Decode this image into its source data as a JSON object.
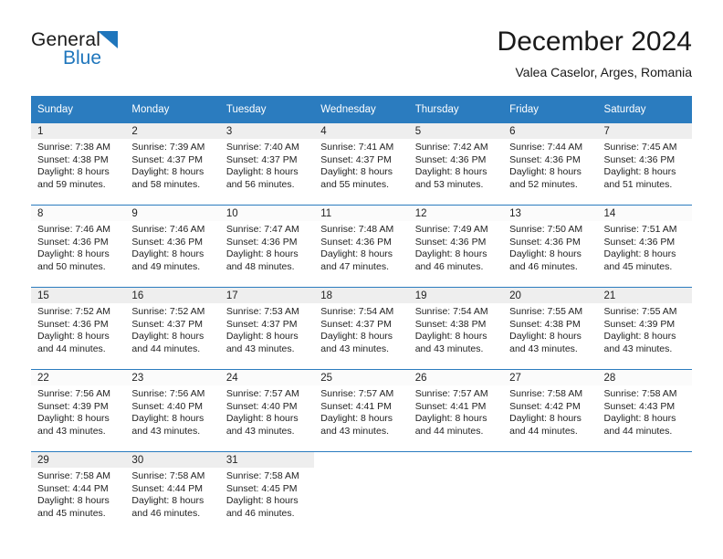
{
  "brand": {
    "name_part1": "General",
    "name_part2": "Blue",
    "accent_color": "#1f76bc"
  },
  "header": {
    "title": "December 2024",
    "subtitle": "Valea Caselor, Arges, Romania"
  },
  "calendar": {
    "header_bg": "#2b7cbf",
    "weekday_headers": [
      "Sunday",
      "Monday",
      "Tuesday",
      "Wednesday",
      "Thursday",
      "Friday",
      "Saturday"
    ],
    "weeks": [
      [
        {
          "day": "1",
          "sunrise": "Sunrise: 7:38 AM",
          "sunset": "Sunset: 4:38 PM",
          "daylight_line1": "Daylight: 8 hours",
          "daylight_line2": "and 59 minutes."
        },
        {
          "day": "2",
          "sunrise": "Sunrise: 7:39 AM",
          "sunset": "Sunset: 4:37 PM",
          "daylight_line1": "Daylight: 8 hours",
          "daylight_line2": "and 58 minutes."
        },
        {
          "day": "3",
          "sunrise": "Sunrise: 7:40 AM",
          "sunset": "Sunset: 4:37 PM",
          "daylight_line1": "Daylight: 8 hours",
          "daylight_line2": "and 56 minutes."
        },
        {
          "day": "4",
          "sunrise": "Sunrise: 7:41 AM",
          "sunset": "Sunset: 4:37 PM",
          "daylight_line1": "Daylight: 8 hours",
          "daylight_line2": "and 55 minutes."
        },
        {
          "day": "5",
          "sunrise": "Sunrise: 7:42 AM",
          "sunset": "Sunset: 4:36 PM",
          "daylight_line1": "Daylight: 8 hours",
          "daylight_line2": "and 53 minutes."
        },
        {
          "day": "6",
          "sunrise": "Sunrise: 7:44 AM",
          "sunset": "Sunset: 4:36 PM",
          "daylight_line1": "Daylight: 8 hours",
          "daylight_line2": "and 52 minutes."
        },
        {
          "day": "7",
          "sunrise": "Sunrise: 7:45 AM",
          "sunset": "Sunset: 4:36 PM",
          "daylight_line1": "Daylight: 8 hours",
          "daylight_line2": "and 51 minutes."
        }
      ],
      [
        {
          "day": "8",
          "sunrise": "Sunrise: 7:46 AM",
          "sunset": "Sunset: 4:36 PM",
          "daylight_line1": "Daylight: 8 hours",
          "daylight_line2": "and 50 minutes."
        },
        {
          "day": "9",
          "sunrise": "Sunrise: 7:46 AM",
          "sunset": "Sunset: 4:36 PM",
          "daylight_line1": "Daylight: 8 hours",
          "daylight_line2": "and 49 minutes."
        },
        {
          "day": "10",
          "sunrise": "Sunrise: 7:47 AM",
          "sunset": "Sunset: 4:36 PM",
          "daylight_line1": "Daylight: 8 hours",
          "daylight_line2": "and 48 minutes."
        },
        {
          "day": "11",
          "sunrise": "Sunrise: 7:48 AM",
          "sunset": "Sunset: 4:36 PM",
          "daylight_line1": "Daylight: 8 hours",
          "daylight_line2": "and 47 minutes."
        },
        {
          "day": "12",
          "sunrise": "Sunrise: 7:49 AM",
          "sunset": "Sunset: 4:36 PM",
          "daylight_line1": "Daylight: 8 hours",
          "daylight_line2": "and 46 minutes."
        },
        {
          "day": "13",
          "sunrise": "Sunrise: 7:50 AM",
          "sunset": "Sunset: 4:36 PM",
          "daylight_line1": "Daylight: 8 hours",
          "daylight_line2": "and 46 minutes."
        },
        {
          "day": "14",
          "sunrise": "Sunrise: 7:51 AM",
          "sunset": "Sunset: 4:36 PM",
          "daylight_line1": "Daylight: 8 hours",
          "daylight_line2": "and 45 minutes."
        }
      ],
      [
        {
          "day": "15",
          "sunrise": "Sunrise: 7:52 AM",
          "sunset": "Sunset: 4:36 PM",
          "daylight_line1": "Daylight: 8 hours",
          "daylight_line2": "and 44 minutes."
        },
        {
          "day": "16",
          "sunrise": "Sunrise: 7:52 AM",
          "sunset": "Sunset: 4:37 PM",
          "daylight_line1": "Daylight: 8 hours",
          "daylight_line2": "and 44 minutes."
        },
        {
          "day": "17",
          "sunrise": "Sunrise: 7:53 AM",
          "sunset": "Sunset: 4:37 PM",
          "daylight_line1": "Daylight: 8 hours",
          "daylight_line2": "and 43 minutes."
        },
        {
          "day": "18",
          "sunrise": "Sunrise: 7:54 AM",
          "sunset": "Sunset: 4:37 PM",
          "daylight_line1": "Daylight: 8 hours",
          "daylight_line2": "and 43 minutes."
        },
        {
          "day": "19",
          "sunrise": "Sunrise: 7:54 AM",
          "sunset": "Sunset: 4:38 PM",
          "daylight_line1": "Daylight: 8 hours",
          "daylight_line2": "and 43 minutes."
        },
        {
          "day": "20",
          "sunrise": "Sunrise: 7:55 AM",
          "sunset": "Sunset: 4:38 PM",
          "daylight_line1": "Daylight: 8 hours",
          "daylight_line2": "and 43 minutes."
        },
        {
          "day": "21",
          "sunrise": "Sunrise: 7:55 AM",
          "sunset": "Sunset: 4:39 PM",
          "daylight_line1": "Daylight: 8 hours",
          "daylight_line2": "and 43 minutes."
        }
      ],
      [
        {
          "day": "22",
          "sunrise": "Sunrise: 7:56 AM",
          "sunset": "Sunset: 4:39 PM",
          "daylight_line1": "Daylight: 8 hours",
          "daylight_line2": "and 43 minutes."
        },
        {
          "day": "23",
          "sunrise": "Sunrise: 7:56 AM",
          "sunset": "Sunset: 4:40 PM",
          "daylight_line1": "Daylight: 8 hours",
          "daylight_line2": "and 43 minutes."
        },
        {
          "day": "24",
          "sunrise": "Sunrise: 7:57 AM",
          "sunset": "Sunset: 4:40 PM",
          "daylight_line1": "Daylight: 8 hours",
          "daylight_line2": "and 43 minutes."
        },
        {
          "day": "25",
          "sunrise": "Sunrise: 7:57 AM",
          "sunset": "Sunset: 4:41 PM",
          "daylight_line1": "Daylight: 8 hours",
          "daylight_line2": "and 43 minutes."
        },
        {
          "day": "26",
          "sunrise": "Sunrise: 7:57 AM",
          "sunset": "Sunset: 4:41 PM",
          "daylight_line1": "Daylight: 8 hours",
          "daylight_line2": "and 44 minutes."
        },
        {
          "day": "27",
          "sunrise": "Sunrise: 7:58 AM",
          "sunset": "Sunset: 4:42 PM",
          "daylight_line1": "Daylight: 8 hours",
          "daylight_line2": "and 44 minutes."
        },
        {
          "day": "28",
          "sunrise": "Sunrise: 7:58 AM",
          "sunset": "Sunset: 4:43 PM",
          "daylight_line1": "Daylight: 8 hours",
          "daylight_line2": "and 44 minutes."
        }
      ],
      [
        {
          "day": "29",
          "sunrise": "Sunrise: 7:58 AM",
          "sunset": "Sunset: 4:44 PM",
          "daylight_line1": "Daylight: 8 hours",
          "daylight_line2": "and 45 minutes."
        },
        {
          "day": "30",
          "sunrise": "Sunrise: 7:58 AM",
          "sunset": "Sunset: 4:44 PM",
          "daylight_line1": "Daylight: 8 hours",
          "daylight_line2": "and 46 minutes."
        },
        {
          "day": "31",
          "sunrise": "Sunrise: 7:58 AM",
          "sunset": "Sunset: 4:45 PM",
          "daylight_line1": "Daylight: 8 hours",
          "daylight_line2": "and 46 minutes."
        },
        {
          "day": "",
          "sunrise": "",
          "sunset": "",
          "daylight_line1": "",
          "daylight_line2": ""
        },
        {
          "day": "",
          "sunrise": "",
          "sunset": "",
          "daylight_line1": "",
          "daylight_line2": ""
        },
        {
          "day": "",
          "sunrise": "",
          "sunset": "",
          "daylight_line1": "",
          "daylight_line2": ""
        },
        {
          "day": "",
          "sunrise": "",
          "sunset": "",
          "daylight_line1": "",
          "daylight_line2": ""
        }
      ]
    ]
  }
}
